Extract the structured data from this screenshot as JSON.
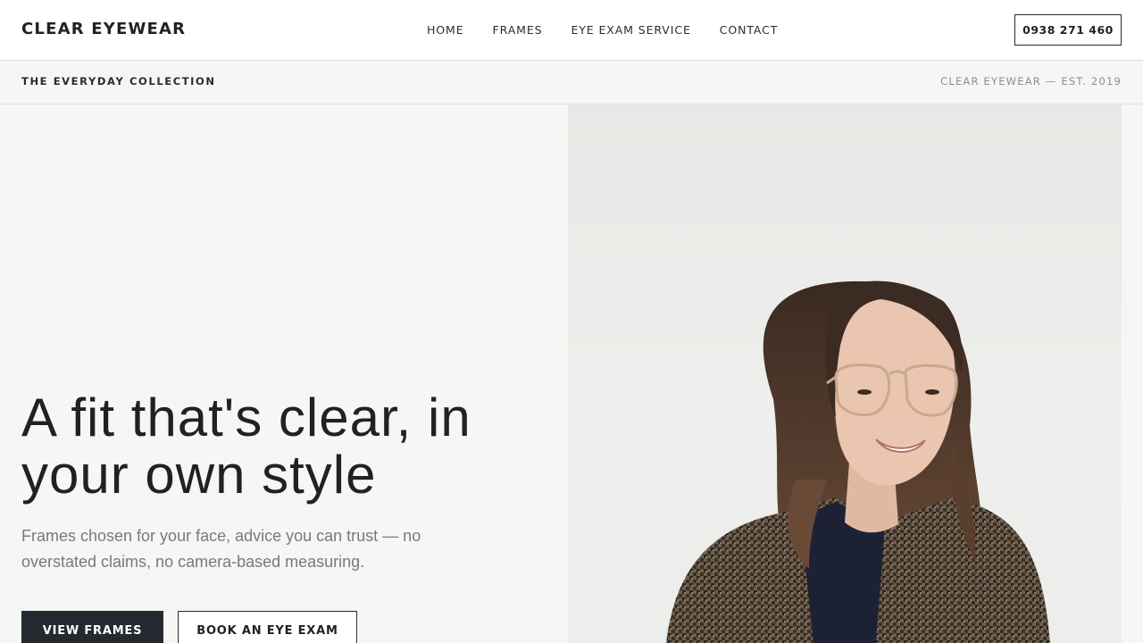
{
  "header": {
    "brand": "CLEAR EYEWEAR",
    "nav": [
      {
        "label": "HOME"
      },
      {
        "label": "FRAMES"
      },
      {
        "label": "EYE EXAM SERVICE"
      },
      {
        "label": "CONTACT"
      }
    ],
    "phone": "0938 271 460"
  },
  "subbar": {
    "collection": "THE EVERYDAY COLLECTION",
    "est": "CLEAR EYEWEAR — EST. 2019"
  },
  "hero": {
    "headline": "A fit that's clear, in your own style",
    "subcopy": "Frames chosen for your face, advice you can trust — no overstated claims, no camera-based measuring.",
    "primary_button": "VIEW FRAMES",
    "secondary_button": "BOOK AN EYE EXAM"
  },
  "colors": {
    "background": "#f6f6f4",
    "text": "#1f2124",
    "muted": "#767a80",
    "primary_button": "#252a31"
  }
}
